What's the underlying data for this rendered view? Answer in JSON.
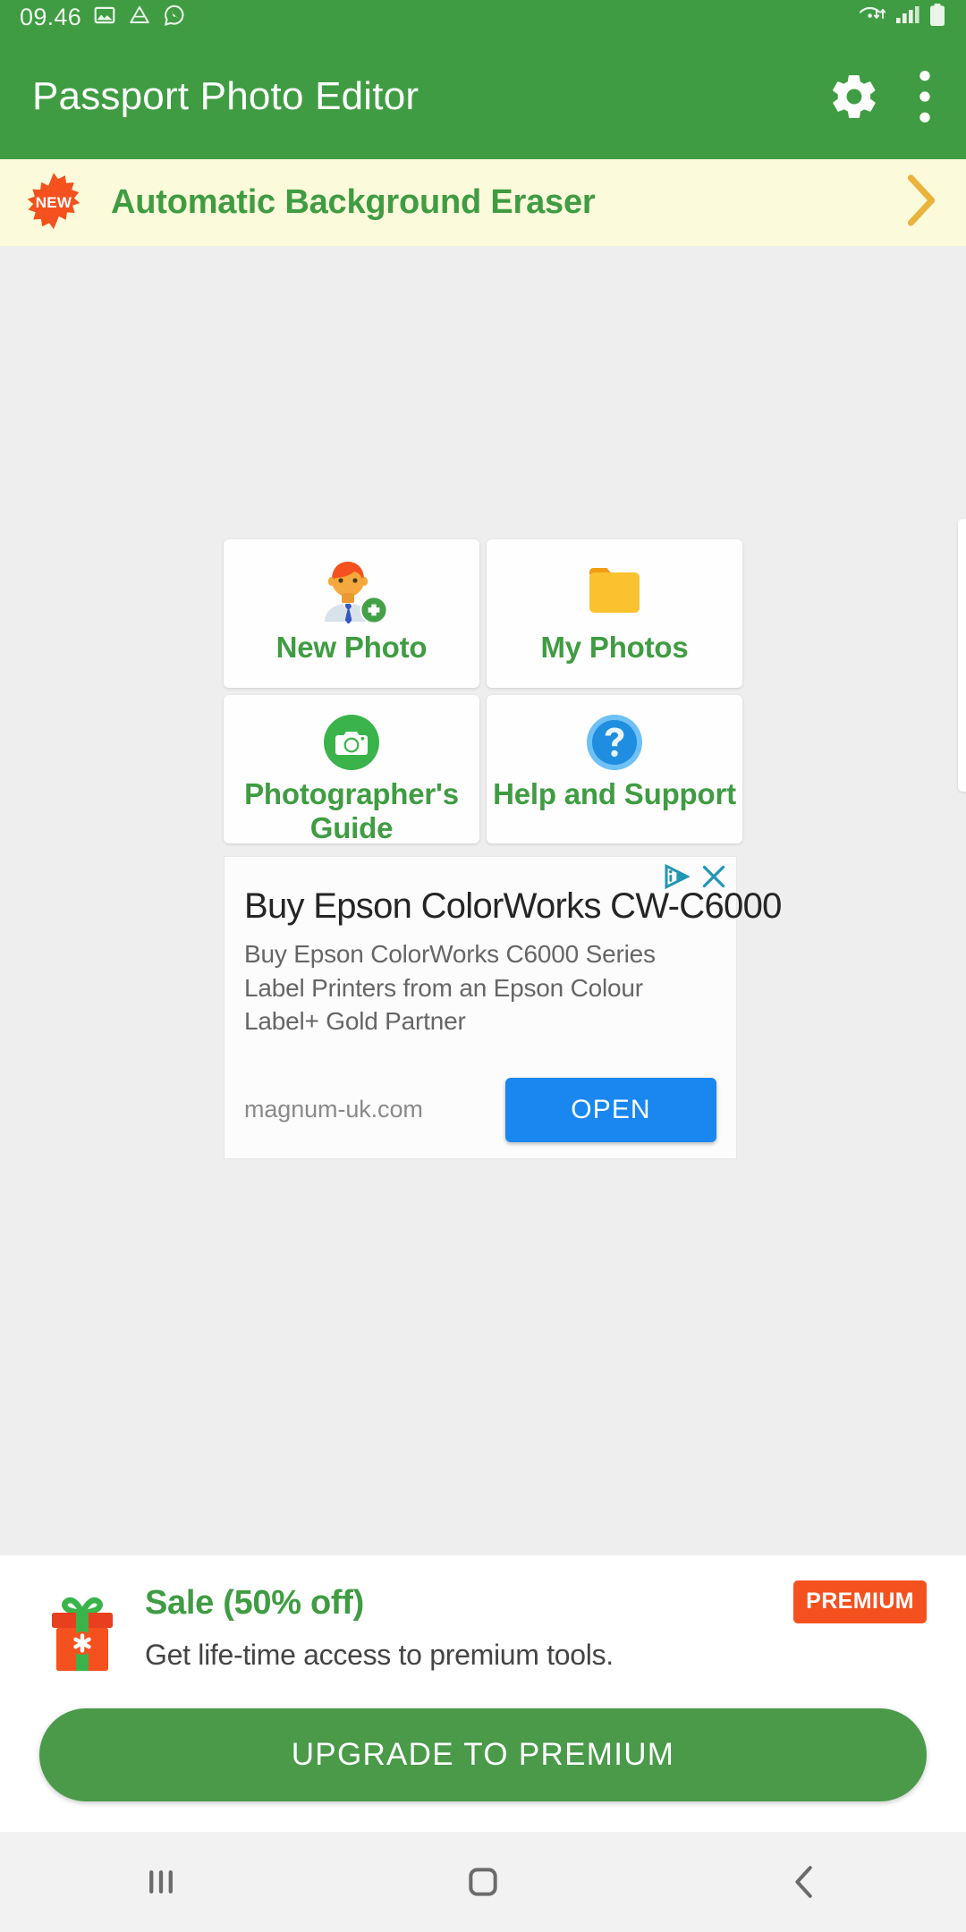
{
  "status_bar": {
    "time": "09.46",
    "left_icons": [
      "photos-icon",
      "drive-icon",
      "whatsapp-icon"
    ],
    "right_icons": [
      "wifi-transfer-icon",
      "cellular-signal-icon",
      "battery-icon"
    ]
  },
  "app_bar": {
    "title": "Passport Photo Editor",
    "settings_icon": "gear-icon",
    "overflow_icon": "more-vertical-icon",
    "background_color": "#3f9c42"
  },
  "promo_banner": {
    "badge_label": "NEW",
    "text": "Automatic Background Eraser",
    "chevron_icon": "chevron-right-icon",
    "background_color": "#fbfada",
    "text_color": "#3f9c42",
    "badge_color": "#f4511e"
  },
  "tiles": [
    {
      "label": "New Photo",
      "icon": "person-add-icon"
    },
    {
      "label": "My Photos",
      "icon": "folder-icon"
    },
    {
      "label": "Photographer's Guide",
      "icon": "camera-circle-icon"
    },
    {
      "label": "Help and Support",
      "icon": "question-circle-icon"
    }
  ],
  "ad": {
    "adchoices_icon": "adchoices-icon",
    "close_icon": "close-icon",
    "title": "Buy Epson ColorWorks CW-C6000",
    "description": "Buy Epson ColorWorks C6000 Series Label Printers from an Epson Colour Label+ Gold Partner",
    "url": "magnum-uk.com",
    "cta_label": "OPEN",
    "cta_color": "#1a87f0"
  },
  "premium": {
    "gift_icon": "gift-icon",
    "title": "Sale (50% off)",
    "subtitle": "Get life-time access to premium tools.",
    "badge_label": "PREMIUM",
    "badge_color": "#f4511e",
    "button_label": "UPGRADE TO PREMIUM",
    "button_color": "#4a9a4a"
  },
  "nav_bar": {
    "recents_icon": "recents-icon",
    "home_icon": "home-icon",
    "back_icon": "back-icon"
  }
}
